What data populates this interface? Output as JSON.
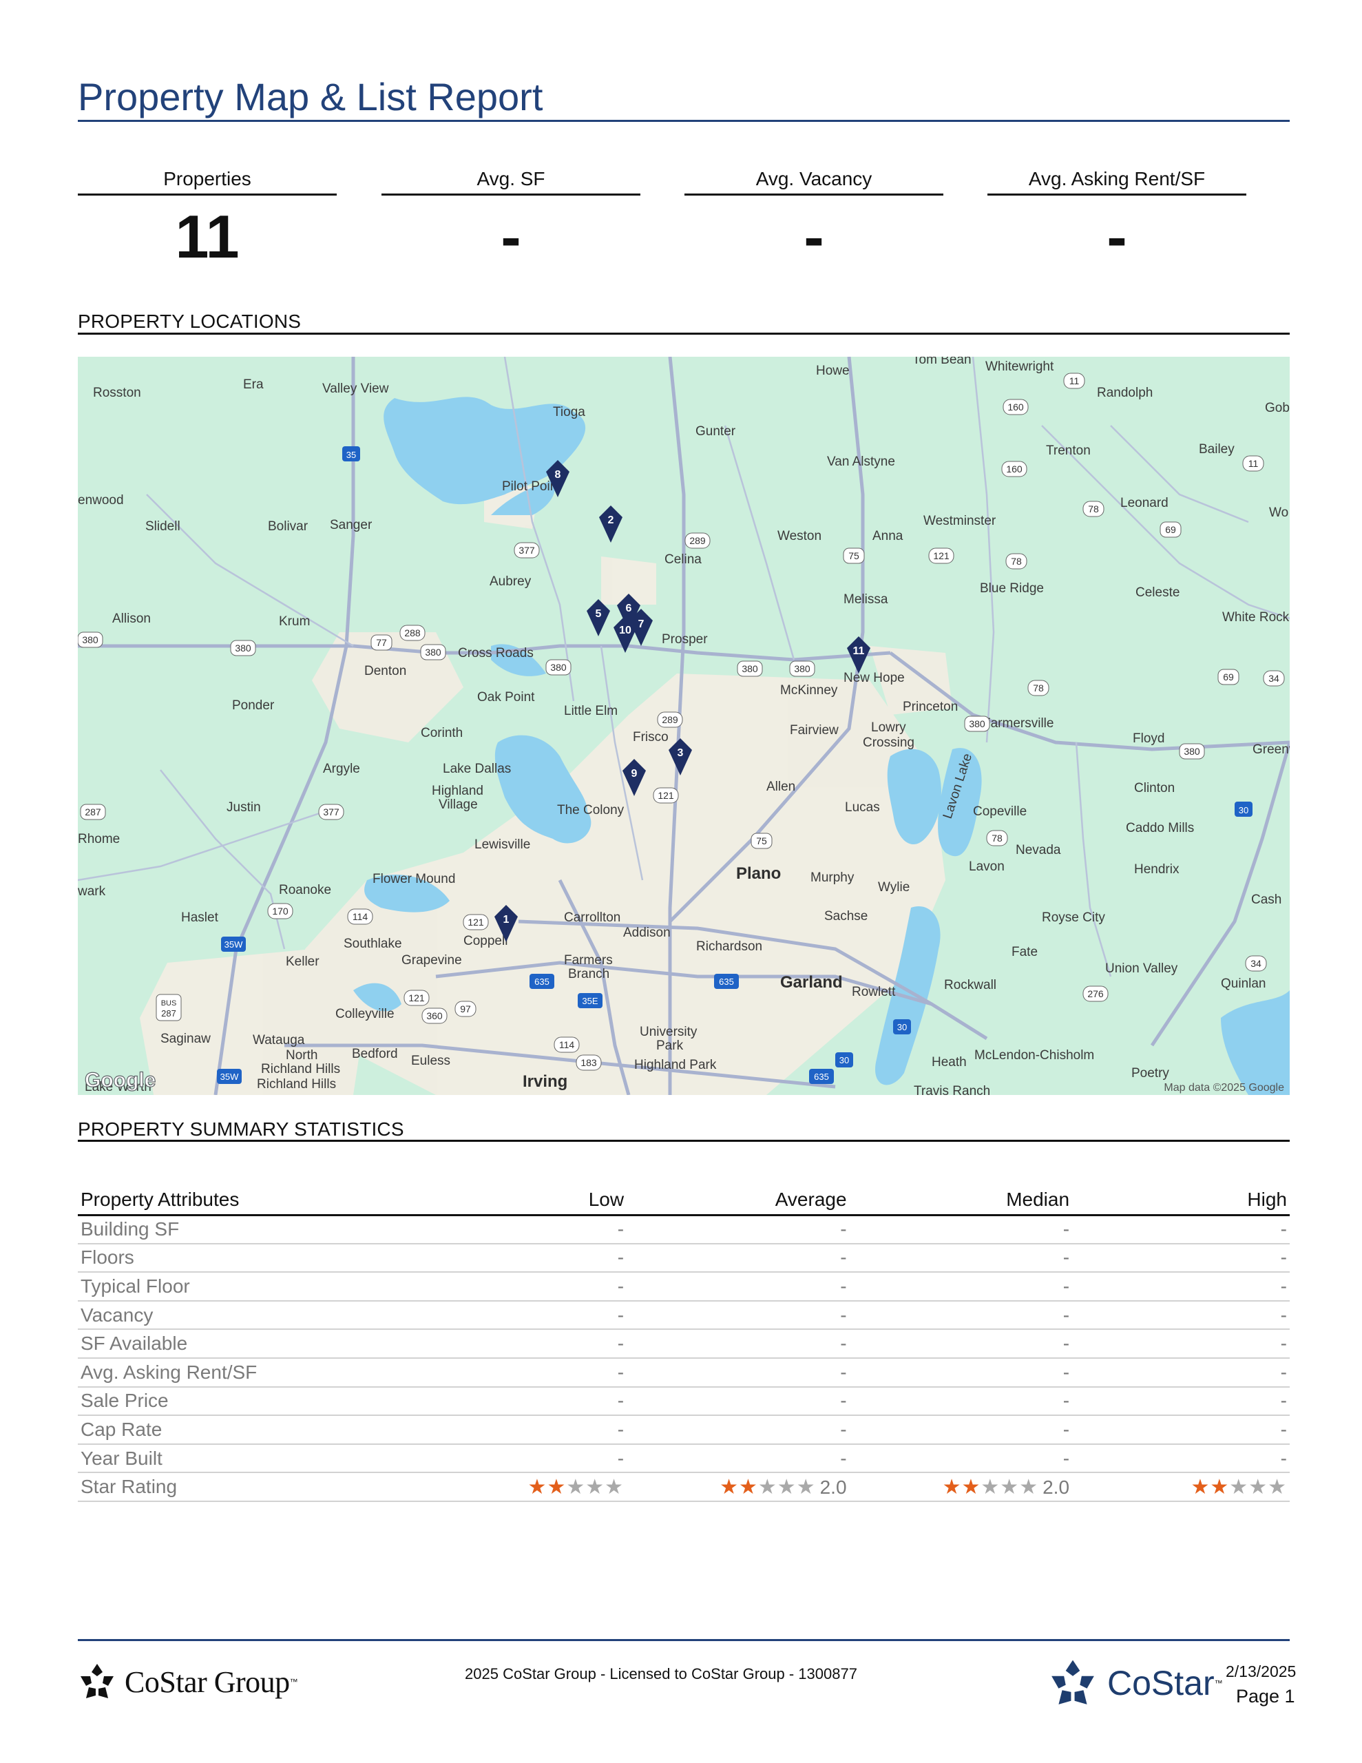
{
  "report": {
    "title": "Property Map & List Report"
  },
  "metrics": [
    {
      "label": "Properties",
      "value": "11"
    },
    {
      "label": "Avg. SF",
      "value": "-"
    },
    {
      "label": "Avg. Vacancy",
      "value": "-"
    },
    {
      "label": "Avg. Asking Rent/SF",
      "value": "-"
    }
  ],
  "sections": {
    "locations": "PROPERTY LOCATIONS",
    "summary": "PROPERTY SUMMARY STATISTICS"
  },
  "map": {
    "attribution": "Map data ©2025 Google",
    "logo": "Google",
    "colors": {
      "land": "#cdefdd",
      "water": "#8fd0ef",
      "urban": "#f1ede3",
      "road": "#a8b2cf",
      "marker": "#1e2e63"
    },
    "markers": [
      "1",
      "2",
      "3",
      "5",
      "6",
      "7",
      "8",
      "9",
      "10",
      "11"
    ],
    "places": [
      "Rosston",
      "Era",
      "Valley View",
      "Tioga",
      "Gunter",
      "Howe",
      "Tom Bean",
      "Whitewright",
      "Randolph",
      "Gob",
      "Van Alstyne",
      "Trenton",
      "Bailey",
      "Pilot Point",
      "Weston",
      "Anna",
      "Westminster",
      "Leonard",
      "Wo",
      "enwood",
      "Slidell",
      "Bolivar",
      "Sanger",
      "Celina",
      "Aubrey",
      "Melissa",
      "Blue Ridge",
      "Celeste",
      "White Rock",
      "Allison",
      "Krum",
      "Cross Roads",
      "Prosper",
      "Denton",
      "McKinney",
      "New Hope",
      "Ponder",
      "Oak Point",
      "Little Elm",
      "Princeton",
      "Farmersville",
      "Floyd",
      "Greenvil",
      "Corinth",
      "Frisco",
      "Fairview",
      "Lowry Crossing",
      "Argyle",
      "Lake Dallas",
      "Highland Village",
      "Allen",
      "Clinton",
      "Justin",
      "The Colony",
      "Lucas",
      "Copeville",
      "Caddo Mills",
      "Rhome",
      "Lewisville",
      "Nevada",
      "Flower Mound",
      "Plano",
      "Murphy",
      "Lavon",
      "Hendrix",
      "wark",
      "Roanoke",
      "Wylie",
      "Haslet",
      "Carrollton",
      "Sachse",
      "Royse City",
      "Cash",
      "Southlake",
      "Coppell",
      "Addison",
      "Richardson",
      "Keller",
      "Grapevine",
      "Farmers Branch",
      "Fate",
      "Union Valley",
      "Garland",
      "Rowlett",
      "Rockwall",
      "Quinlan",
      "Colleyville",
      "Saginaw",
      "Watauga",
      "Bedford",
      "Euless",
      "University Park",
      "Highland Park",
      "Heath",
      "McLendon-Chisholm",
      "North Richland Hills",
      "Richland Hills",
      "Irving",
      "Poetry",
      "Travis Ranch",
      "Lavon Lake",
      "Lake Worth"
    ],
    "shields": [
      "35",
      "377",
      "289",
      "75",
      "121",
      "160",
      "11",
      "78",
      "69",
      "380",
      "288",
      "77",
      "35E",
      "35W",
      "114",
      "170",
      "360",
      "97",
      "183",
      "635",
      "30",
      "34",
      "276",
      "287",
      "BUS 287"
    ]
  },
  "summary_table": {
    "headers": [
      "Property Attributes",
      "Low",
      "Average",
      "Median",
      "High"
    ],
    "rows": [
      [
        "Building SF",
        "-",
        "-",
        "-",
        "-"
      ],
      [
        "Floors",
        "-",
        "-",
        "-",
        "-"
      ],
      [
        "Typical Floor",
        "-",
        "-",
        "-",
        "-"
      ],
      [
        "Vacancy",
        "-",
        "-",
        "-",
        "-"
      ],
      [
        "SF Available",
        "-",
        "-",
        "-",
        "-"
      ],
      [
        "Avg. Asking Rent/SF",
        "-",
        "-",
        "-",
        "-"
      ],
      [
        "Sale Price",
        "-",
        "-",
        "-",
        "-"
      ],
      [
        "Cap Rate",
        "-",
        "-",
        "-",
        "-"
      ],
      [
        "Year Built",
        "-",
        "-",
        "-",
        "-"
      ]
    ],
    "star_row": {
      "label": "Star Rating",
      "low_stars": 2,
      "average_stars": 2,
      "average_text": "2.0",
      "median_stars": 2,
      "median_text": "2.0",
      "high_stars": 2,
      "max_stars": 5
    }
  },
  "footer": {
    "left_logo": "CoStar Group",
    "copyright": "2025 CoStar Group - Licensed to CoStar Group - 1300877",
    "right_logo": "CoStar",
    "date": "2/13/2025",
    "page": "Page 1"
  }
}
